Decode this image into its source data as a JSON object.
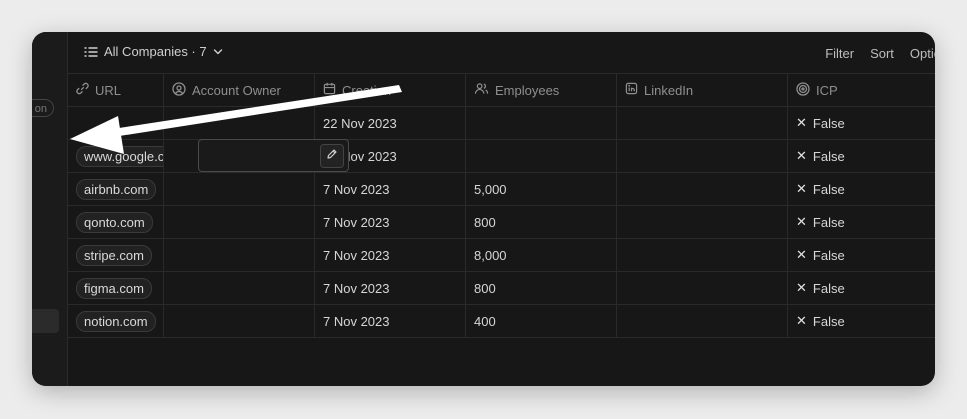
{
  "view": {
    "title": "All Companies · 7"
  },
  "toolbar": {
    "filter_label": "Filter",
    "sort_label": "Sort",
    "options_label": "Optio"
  },
  "sidebar": {
    "chip_label": "on"
  },
  "columns": [
    {
      "label": "URL",
      "icon": "link-icon"
    },
    {
      "label": "Account Owner",
      "icon": "user-circle-icon"
    },
    {
      "label": "Creation",
      "icon": "calendar-icon"
    },
    {
      "label": "Employees",
      "icon": "users-icon"
    },
    {
      "label": "LinkedIn",
      "icon": "linkedin-icon"
    },
    {
      "label": "ICP",
      "icon": "target-icon"
    }
  ],
  "rows": [
    {
      "url": "",
      "created": "22 Nov 2023",
      "employees": "",
      "icp": "False"
    },
    {
      "url": "www.google.c",
      "created": "22 Nov 2023",
      "employees": "",
      "icp": "False"
    },
    {
      "url": "airbnb.com",
      "created": "7 Nov 2023",
      "employees": "5,000",
      "icp": "False"
    },
    {
      "url": "qonto.com",
      "created": "7 Nov 2023",
      "employees": "800",
      "icp": "False"
    },
    {
      "url": "stripe.com",
      "created": "7 Nov 2023",
      "employees": "8,000",
      "icp": "False"
    },
    {
      "url": "figma.com",
      "created": "7 Nov 2023",
      "employees": "800",
      "icp": "False"
    },
    {
      "url": "notion.com",
      "created": "7 Nov 2023",
      "employees": "400",
      "icp": "False"
    }
  ],
  "colors": {
    "background": "#171717",
    "border": "#2a2a2a",
    "text": "#d6d6d6",
    "muted": "#8f8f8f",
    "annotation_arrow": "#ffffff"
  }
}
